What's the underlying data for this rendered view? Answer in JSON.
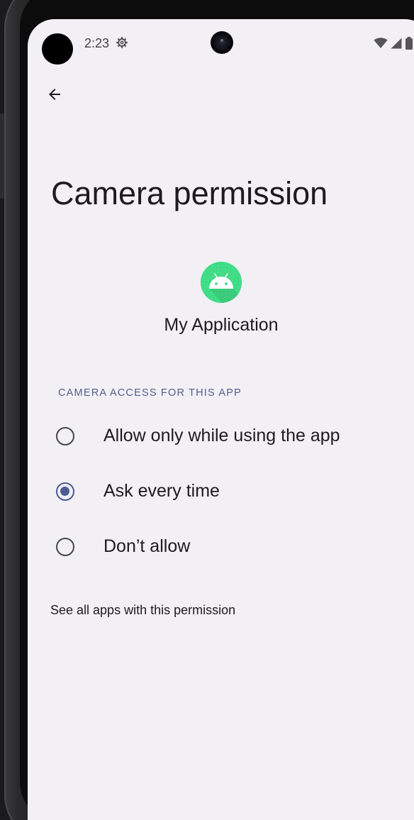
{
  "status_bar": {
    "time": "2:23",
    "icons": [
      "gear-icon",
      "wifi-icon",
      "cellular-signal-icon",
      "battery-icon"
    ]
  },
  "toolbar": {
    "back_icon": "arrow-back-icon"
  },
  "page": {
    "title": "Camera permission"
  },
  "app": {
    "name": "My Application",
    "icon": "android-app-icon",
    "icon_color": "#3ddc84"
  },
  "permission": {
    "section_header": "CAMERA ACCESS FOR THIS APP",
    "options": [
      {
        "label": "Allow only while using the app",
        "selected": false
      },
      {
        "label": "Ask every time",
        "selected": true
      },
      {
        "label": "Don’t allow",
        "selected": false
      }
    ],
    "see_all_link": "See all apps with this permission"
  },
  "colors": {
    "background": "#f2f0f5",
    "accent": "#4d5c92",
    "text": "#1c1b1f",
    "section_header": "#52608a"
  }
}
